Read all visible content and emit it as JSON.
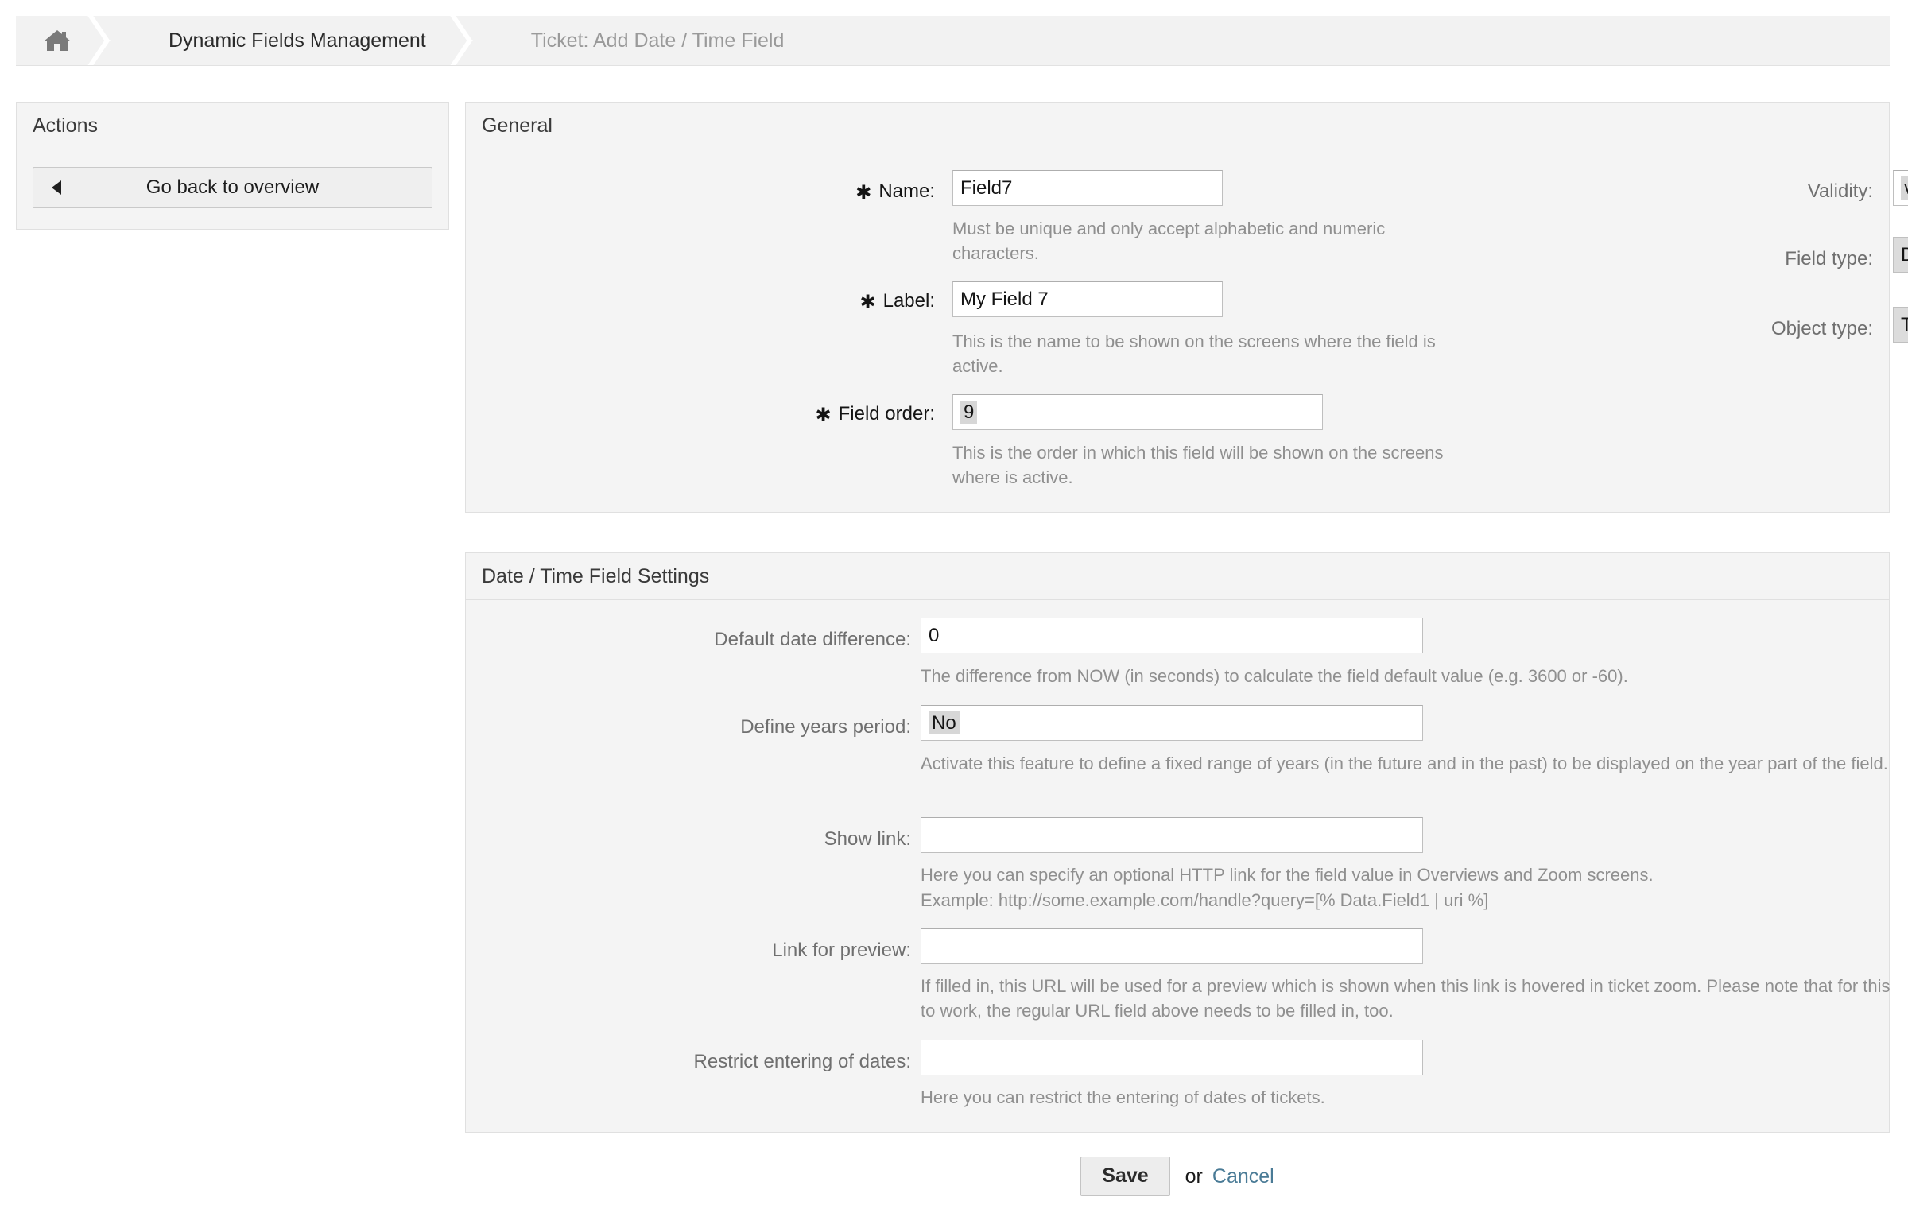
{
  "breadcrumb": {
    "home_icon": "home-icon",
    "items": [
      {
        "label": "Dynamic Fields Management",
        "active": true
      },
      {
        "label": "Ticket: Add Date / Time Field",
        "active": false
      }
    ]
  },
  "sidebar": {
    "header": "Actions",
    "go_back_label": "Go back to overview",
    "back_icon": "caret-left-icon"
  },
  "general": {
    "header": "General",
    "name": {
      "label": "Name:",
      "required_marker": "✱",
      "value": "Field7",
      "hint": "Must be unique and only accept alphabetic and numeric characters."
    },
    "label_field": {
      "label": "Label:",
      "required_marker": "✱",
      "value": "My Field 7",
      "hint": "This is the name to be shown on the screens where the field is active."
    },
    "field_order": {
      "label": "Field order:",
      "required_marker": "✱",
      "value": "9",
      "hint": "This is the order in which this field will be shown on the screens where is active."
    },
    "validity": {
      "label": "Validity:",
      "value": "valid"
    },
    "field_type": {
      "label": "Field type:",
      "value": "Date / Time"
    },
    "object_type": {
      "label": "Object type:",
      "value": "Ticket"
    }
  },
  "settings": {
    "header": "Date / Time Field Settings",
    "default_date_difference": {
      "label": "Default date difference:",
      "value": "0",
      "hint": "The difference from NOW (in seconds) to calculate the field default value (e.g. 3600 or -60)."
    },
    "define_years_period": {
      "label": "Define years period:",
      "value": "No",
      "hint": "Activate this feature to define a fixed range of years (in the future and in the past) to be displayed on the year part of the field."
    },
    "show_link": {
      "label": "Show link:",
      "value": "",
      "placeholder": "",
      "hint": "Here you can specify an optional HTTP link for the field value in Overviews and Zoom screens.",
      "hint2": "Example: http://some.example.com/handle?query=[% Data.Field1 | uri %]"
    },
    "link_for_preview": {
      "label": "Link for preview:",
      "value": "",
      "placeholder": "",
      "hint": "If filled in, this URL will be used for a preview which is shown when this link is hovered in ticket zoom. Please note that for this to work, the regular URL field above needs to be filled in, too."
    },
    "restrict_entering_of_dates": {
      "label": "Restrict entering of dates:",
      "value": "",
      "placeholder": "",
      "hint": "Here you can restrict the entering of dates of tickets."
    }
  },
  "footer": {
    "save_label": "Save",
    "or_label": "or",
    "cancel_label": "Cancel"
  },
  "colors": {
    "panel_bg": "#f4f4f4",
    "panel_border": "#e0e0e0",
    "hint_text": "#8f8f8f",
    "link": "#4a7b96",
    "selection": "#d7d7d7"
  }
}
